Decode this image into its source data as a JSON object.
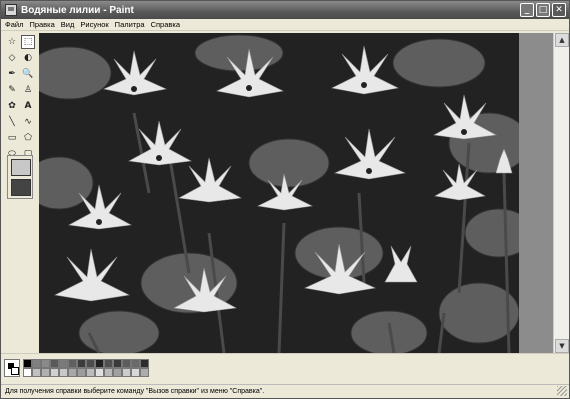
{
  "window": {
    "title": "Водяные лилии - Paint",
    "app_icon": "paint-app-icon"
  },
  "title_buttons": [
    {
      "name": "minimize",
      "glyph": "_"
    },
    {
      "name": "maximize",
      "glyph": "□"
    },
    {
      "name": "close",
      "glyph": "✕"
    }
  ],
  "menu": [
    "Файл",
    "Правка",
    "Вид",
    "Рисунок",
    "Палитра",
    "Справка"
  ],
  "tools": [
    {
      "name": "free-select",
      "glyph": "☆"
    },
    {
      "name": "rect-select",
      "glyph": "⬚"
    },
    {
      "name": "eraser",
      "glyph": "◇"
    },
    {
      "name": "fill",
      "glyph": "◐"
    },
    {
      "name": "pick-color",
      "glyph": "✒"
    },
    {
      "name": "magnifier",
      "glyph": "🔍"
    },
    {
      "name": "pencil",
      "glyph": "✎"
    },
    {
      "name": "brush",
      "glyph": "♙"
    },
    {
      "name": "airbrush",
      "glyph": "✿"
    },
    {
      "name": "text",
      "glyph": "A"
    },
    {
      "name": "line",
      "glyph": "╲"
    },
    {
      "name": "curve",
      "glyph": "∿"
    },
    {
      "name": "rectangle",
      "glyph": "▭"
    },
    {
      "name": "polygon",
      "glyph": "⬠"
    },
    {
      "name": "ellipse",
      "glyph": "⬭"
    },
    {
      "name": "rounded-rect",
      "glyph": "▢"
    }
  ],
  "palette": [
    "#000000",
    "#808080",
    "#8a8a8a",
    "#5a5a5a",
    "#7a7a7a",
    "#606060",
    "#3c3c3c",
    "#4c4c4c",
    "#202020",
    "#505050",
    "#3a3a3a",
    "#5c5c5c",
    "#6a6a6a",
    "#2c2c2c",
    "#ffffff",
    "#c0c0c0",
    "#b0b0b0",
    "#d0d0d0",
    "#c8c8c8",
    "#a8a8a8",
    "#9c9c9c",
    "#bcbcbc",
    "#e0e0e0",
    "#b8b8b8",
    "#a0a0a0",
    "#cccccc",
    "#d8d8d8",
    "#acacac"
  ],
  "colors": {
    "foreground": "#000000",
    "background": "#ffffff"
  },
  "status": "Для получения справки выберите команду \"Вызов справки\" из меню \"Справка\"."
}
